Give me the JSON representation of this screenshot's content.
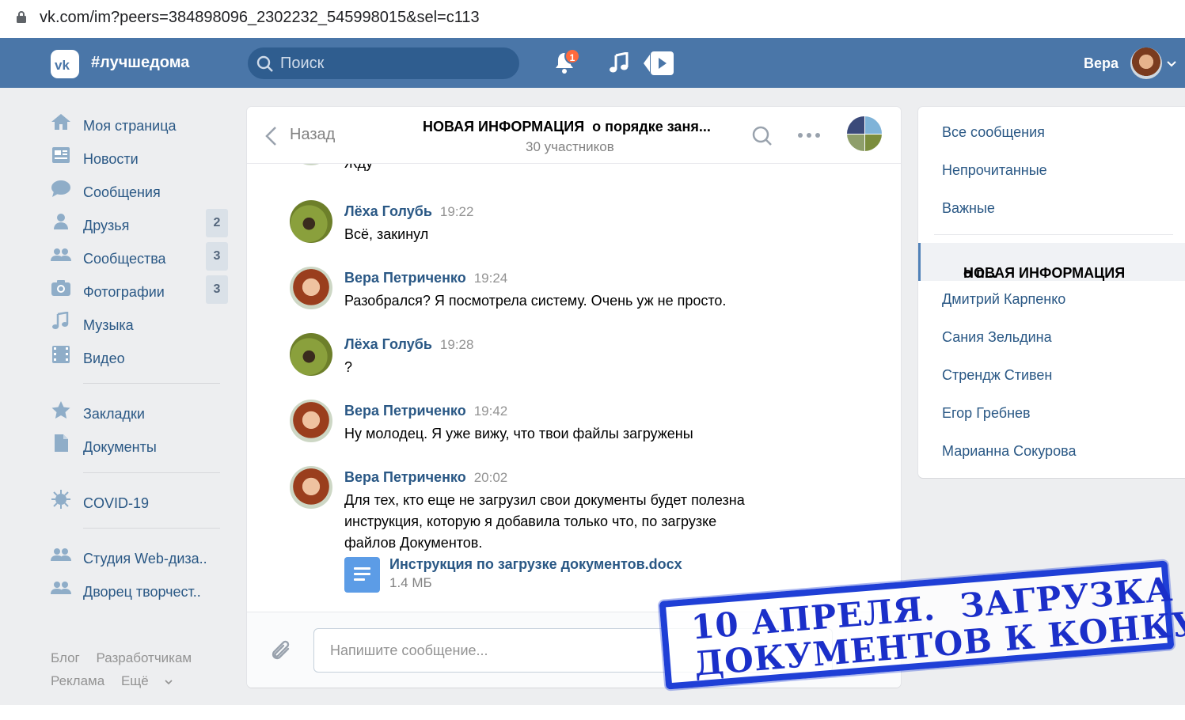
{
  "browser": {
    "url": "vk.com/im?peers=384898096_2302232_545998015&sel=c113"
  },
  "header": {
    "brand": "#лучшедома",
    "search_placeholder": "Поиск",
    "notifications_count": "1",
    "user_name": "Вера",
    "accent": "#4a76a8"
  },
  "leftnav": {
    "items": [
      {
        "label": "Моя страница",
        "icon": "home-icon",
        "count": ""
      },
      {
        "label": "Новости",
        "icon": "news-icon",
        "count": ""
      },
      {
        "label": "Сообщения",
        "icon": "messages-icon",
        "count": ""
      },
      {
        "label": "Друзья",
        "icon": "friends-icon",
        "count": "2"
      },
      {
        "label": "Сообщества",
        "icon": "groups-icon",
        "count": "3"
      },
      {
        "label": "Фотографии",
        "icon": "camera-icon",
        "count": "3"
      },
      {
        "label": "Музыка",
        "icon": "music-icon",
        "count": ""
      },
      {
        "label": "Видео",
        "icon": "video-icon",
        "count": ""
      },
      {
        "label": "Закладки",
        "icon": "star-icon",
        "count": ""
      },
      {
        "label": "Документы",
        "icon": "document-icon",
        "count": ""
      },
      {
        "label": "COVID-19",
        "icon": "virus-icon",
        "count": ""
      },
      {
        "label": "Студия Web-диза..",
        "icon": "groups-icon",
        "count": ""
      },
      {
        "label": "Дворец творчест..",
        "icon": "groups-icon",
        "count": ""
      }
    ],
    "footer": [
      "Блог",
      "Разработчикам",
      "Реклама",
      "Ещё"
    ]
  },
  "chat": {
    "back_label": "Назад",
    "title_bold": "НОВАЯ ИНФОРМАЦИЯ",
    "title_rest": "о порядке заня...",
    "participants": "30 участников",
    "partial_text": "Жду",
    "messages": [
      {
        "author": "Лёха Голубь",
        "time": "19:22",
        "text": "Всё, закинул"
      },
      {
        "author": "Вера Петриченко",
        "time": "19:24",
        "text": "Разобрался? Я посмотрела систему. Очень уж не просто."
      },
      {
        "author": "Лёха Голубь",
        "time": "19:28",
        "text": "?"
      },
      {
        "author": "Вера Петриченко",
        "time": "19:42",
        "text": "Ну молодец. Я уже вижу, что твои файлы загружены"
      },
      {
        "author": "Вера Петриченко",
        "time": "20:02",
        "text_lines": [
          "Для тех, кто еще не загрузил свои документы будет полезна",
          "инструкция, которую я добавила только что, по загрузке",
          "файлов Документов."
        ]
      }
    ],
    "attachment": {
      "name": "Инструкция по загрузке документов.docx",
      "size": "1.4 МБ"
    },
    "composer_placeholder": "Напишите сообщение..."
  },
  "rightmenu": {
    "top": [
      "Все сообщения",
      "Непрочитанные",
      "Важные"
    ],
    "active_bold": "НОВАЯ ИНФОРМАЦИЯ",
    "active_rest": "о п...",
    "dialogs": [
      "Дмитрий Карпенко",
      "Сания Зельдина",
      "Стрендж Стивен",
      "Егор Гребнев",
      "Марианна Сокурова"
    ]
  },
  "stamp": {
    "line1": "10 АПРЕЛЯ.  ЗАГРУЗКА",
    "line2": "ДОКУМЕНТОВ К КОНКУРСУ",
    "color": "#1f3fd6"
  }
}
